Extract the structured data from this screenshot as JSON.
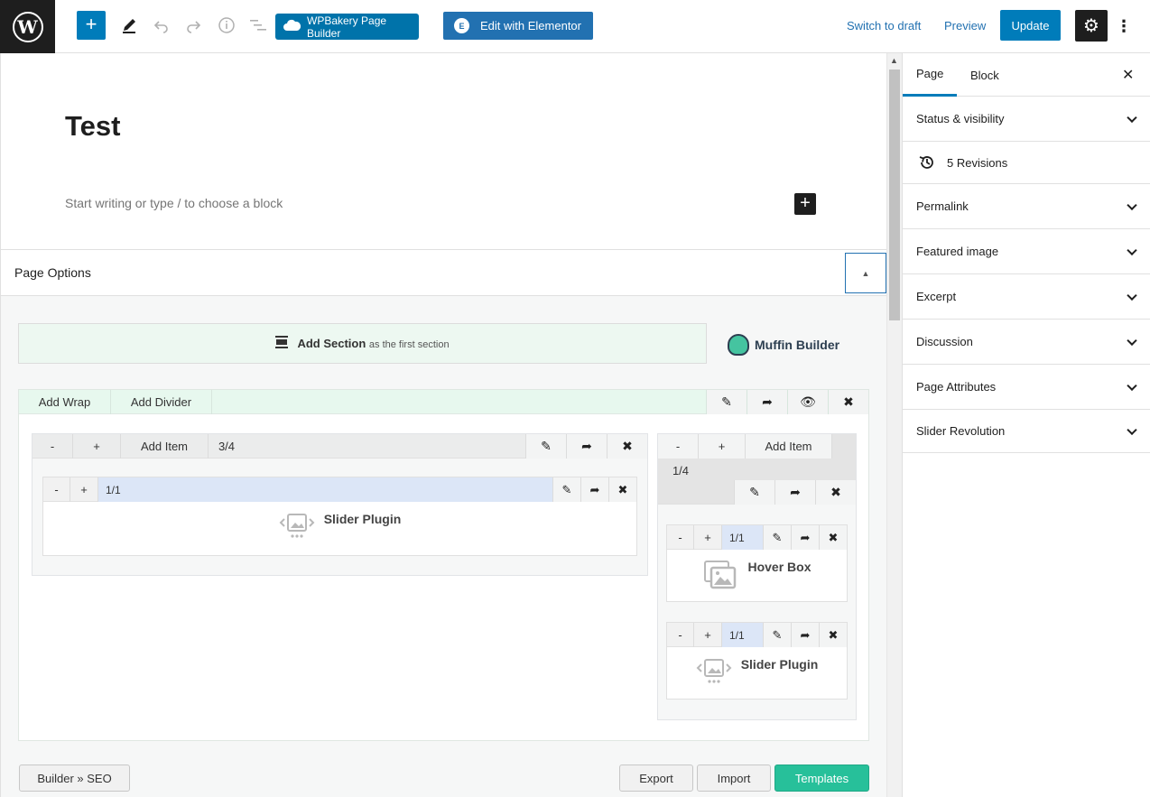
{
  "topbar": {
    "wpbakery_label": "WPBakery Page Builder",
    "elementor_label": "Edit with Elementor",
    "switch_to_draft": "Switch to draft",
    "preview": "Preview",
    "update": "Update"
  },
  "editor": {
    "title": "Test",
    "placeholder": "Start writing or type / to choose a block"
  },
  "page_options": {
    "title": "Page Options"
  },
  "builder": {
    "add_section_bold": "Add Section",
    "add_section_rest": "as the first section",
    "logo_text": "Muffin Builder",
    "section": {
      "add_wrap": "Add Wrap",
      "add_divider": "Add Divider"
    },
    "wrap_left": {
      "minus": "-",
      "plus": "+",
      "add_item": "Add Item",
      "size": "3/4",
      "item": {
        "minus": "-",
        "plus": "+",
        "size": "1/1",
        "title": "Slider Plugin"
      }
    },
    "wrap_right": {
      "minus": "-",
      "plus": "+",
      "add_item": "Add Item",
      "size": "1/4",
      "items": [
        {
          "minus": "-",
          "plus": "+",
          "size": "1/1",
          "title": "Hover Box"
        },
        {
          "minus": "-",
          "plus": "+",
          "size": "1/1",
          "title": "Slider Plugin"
        }
      ]
    },
    "footer": {
      "seo": "Builder » SEO",
      "export": "Export",
      "import": "Import",
      "templates": "Templates"
    }
  },
  "sidebar": {
    "tabs": [
      "Page",
      "Block"
    ],
    "panels": [
      "Status & visibility",
      "5 Revisions",
      "Permalink",
      "Featured image",
      "Excerpt",
      "Discussion",
      "Page Attributes",
      "Slider Revolution"
    ]
  },
  "colors": {
    "wp_blue": "#007cba",
    "builder_green": "#27c09a",
    "dark": "#1e1e1e"
  }
}
